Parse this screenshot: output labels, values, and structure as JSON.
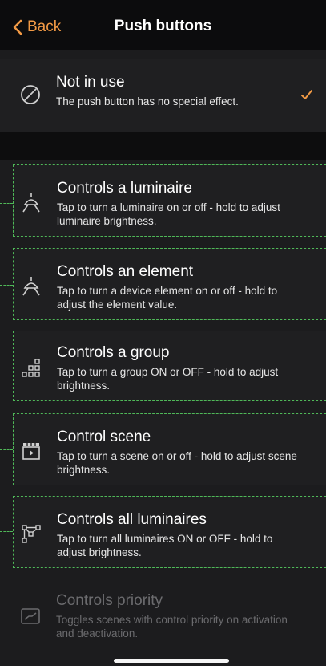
{
  "nav": {
    "back_label": "Back",
    "title": "Push buttons"
  },
  "colors": {
    "accent": "#f29a45",
    "dashed_outline": "#4fb858",
    "background": "#1c1c1e"
  },
  "options": [
    {
      "id": "not-in-use",
      "icon": "not-allowed-icon",
      "title": "Not in use",
      "description": "The push button has no special effect.",
      "selected": true,
      "enabled": true
    },
    {
      "id": "controls-luminaire",
      "icon": "ceiling-lamp-icon",
      "title": "Controls a luminaire",
      "description": "Tap to turn a luminaire on or off - hold to adjust luminaire brightness.",
      "selected": false,
      "enabled": true
    },
    {
      "id": "controls-element",
      "icon": "lamp-element-icon",
      "title": "Controls an element",
      "description": "Tap to turn a device element on or off - hold to adjust the element value.",
      "selected": false,
      "enabled": true
    },
    {
      "id": "controls-group",
      "icon": "group-grid-icon",
      "title": "Controls a group",
      "description": "Tap to turn a group ON or OFF - hold to adjust brightness.",
      "selected": false,
      "enabled": true
    },
    {
      "id": "control-scene",
      "icon": "clapperboard-icon",
      "title": "Control scene",
      "description": "Tap to turn a scene on or off - hold to adjust scene brightness.",
      "selected": false,
      "enabled": true
    },
    {
      "id": "controls-all-luminaires",
      "icon": "network-nodes-icon",
      "title": "Controls all luminaires",
      "description": "Tap to turn all luminaires ON or OFF - hold to adjust brightness.",
      "selected": false,
      "enabled": true
    },
    {
      "id": "controls-priority",
      "icon": "priority-graph-icon",
      "title": "Controls priority",
      "description": "Toggles scenes with control priority on activation and deactivation.",
      "selected": false,
      "enabled": false
    }
  ]
}
